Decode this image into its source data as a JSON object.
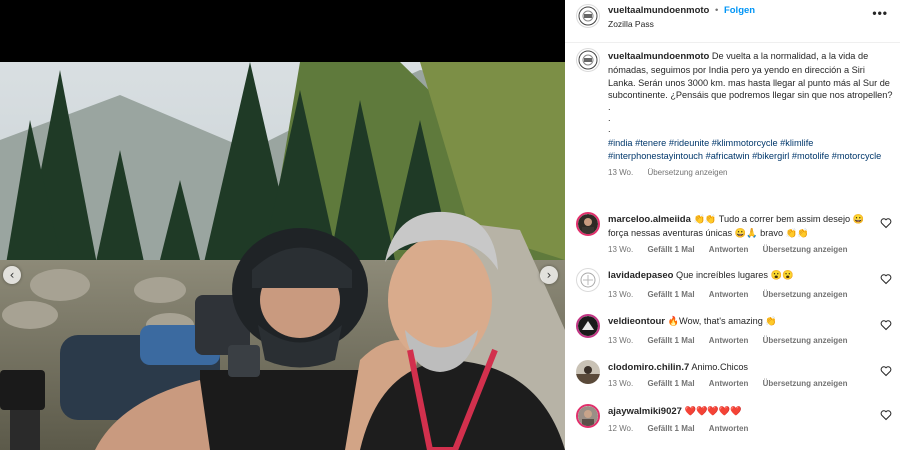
{
  "post": {
    "author": "vueltaalmundoenmoto",
    "follow_label": "Folgen",
    "separator": "•",
    "location": "Zozilla Pass",
    "more_label": "•••",
    "prev_arrow": "‹",
    "next_arrow": "›"
  },
  "caption": {
    "username": "vueltaalmundoenmoto",
    "text": "De vuelta a la normalidad, a la vida de nómadas, seguimos por India pero ya yendo en dirección a Siri Lanka. Serán unos 3000 km. mas hasta llegar al punto más al Sur de subcontinente. ¿Pensáis que podremos llegar sin que nos atropellen?",
    "dots": [
      ".",
      ".",
      "."
    ],
    "hashtags": [
      "#india",
      "#tenere",
      "#rideunite",
      "#klimmotorcycle",
      "#klimlife",
      "#interphonestayintouch",
      "#africatwin",
      "#bikergirl",
      "#motolife",
      "#motorcycle"
    ],
    "time": "13 Wo.",
    "translate_label": "Übersetzung anzeigen"
  },
  "comments": [
    {
      "username": "marceloo.almeiida",
      "text": "👏👏 Tudo a correr bem assim desejo 😀 força nessas aventuras únicas 😀🙏 bravo 👏👏",
      "time": "13 Wo.",
      "likes": "Gefällt 1 Mal",
      "reply": "Antworten",
      "translate": "Übersetzung anzeigen"
    },
    {
      "username": "lavidadepaseo",
      "text": "Que increíbles lugares 😮😮",
      "time": "13 Wo.",
      "likes": "Gefällt 1 Mal",
      "reply": "Antworten",
      "translate": "Übersetzung anzeigen"
    },
    {
      "username": "veldieontour",
      "text": "🔥Wow, that's amazing 👏",
      "time": "13 Wo.",
      "likes": "Gefällt 1 Mal",
      "reply": "Antworten",
      "translate": "Übersetzung anzeigen"
    },
    {
      "username": "clodomiro.chilin.7",
      "text": "Animo.Chicos",
      "time": "13 Wo.",
      "likes": "Gefällt 1 Mal",
      "reply": "Antworten",
      "translate": "Übersetzung anzeigen"
    },
    {
      "username": "ajaywalmiki9027",
      "text": "❤️❤️❤️❤️❤️",
      "time": "12 Wo.",
      "likes": "Gefällt 1 Mal",
      "reply": "Antworten",
      "translate": ""
    }
  ],
  "colors": {
    "link": "#00376b",
    "follow": "#0095f6",
    "muted": "#737373"
  }
}
